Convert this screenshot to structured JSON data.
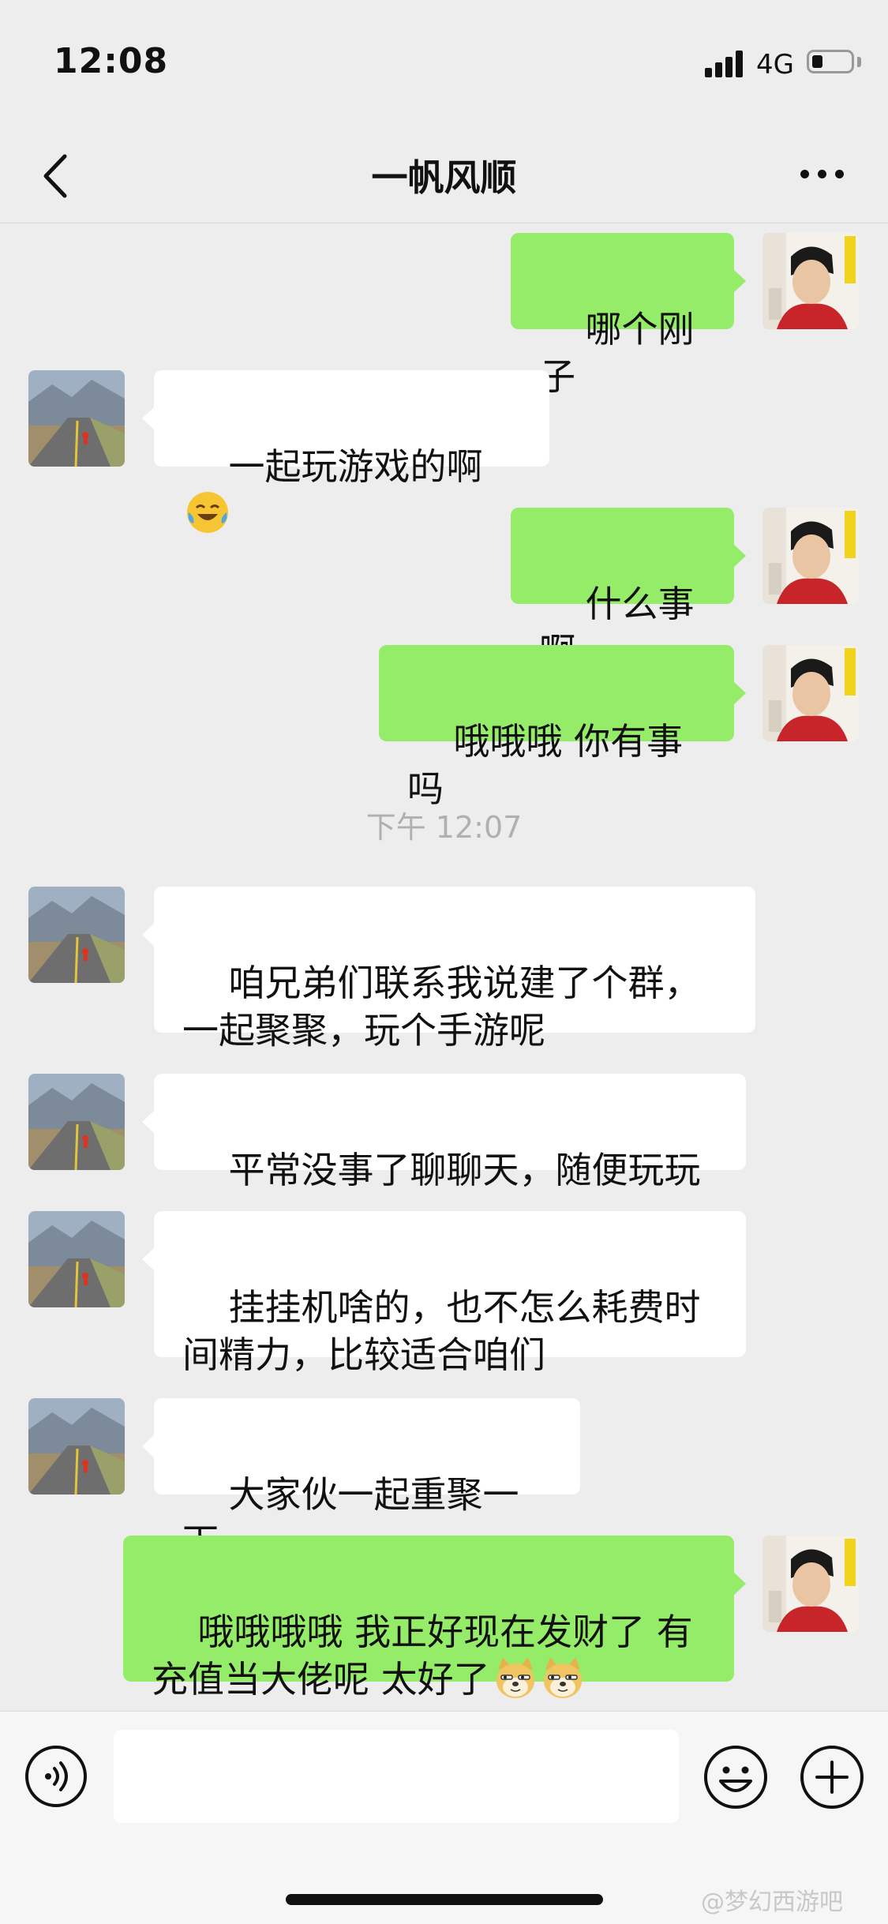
{
  "status_bar": {
    "time": "12:08",
    "network": "4G"
  },
  "header": {
    "title": "一帆风顺"
  },
  "messages": [
    {
      "side": "out",
      "text": "哪个刚子"
    },
    {
      "side": "in",
      "text": "一起玩游戏的啊",
      "emoji": "crying-laughing-emoji"
    },
    {
      "side": "out",
      "text": "什么事啊"
    },
    {
      "side": "out",
      "text": "哦哦哦 你有事吗"
    },
    {
      "side": "in",
      "text": "咱兄弟们联系我说建了个群，\n一起聚聚，玩个手游呢"
    },
    {
      "side": "in",
      "text": "平常没事了聊聊天，随便玩玩"
    },
    {
      "side": "in",
      "text": "挂挂机啥的，也不怎么耗费时\n间精力，比较适合咱们"
    },
    {
      "side": "in",
      "text": "大家伙一起重聚一下"
    },
    {
      "side": "out",
      "text": "哦哦哦哦 我正好现在发财了 有\n充值当大佬呢 太好了",
      "emoji": "doge-emoji"
    }
  ],
  "timestamp": "下午 12:07",
  "input": {
    "placeholder": ""
  },
  "watermark": "@梦幻西游吧",
  "colors": {
    "background": "#ededed",
    "outgoing_bubble": "#95ec69",
    "incoming_bubble": "#ffffff"
  }
}
